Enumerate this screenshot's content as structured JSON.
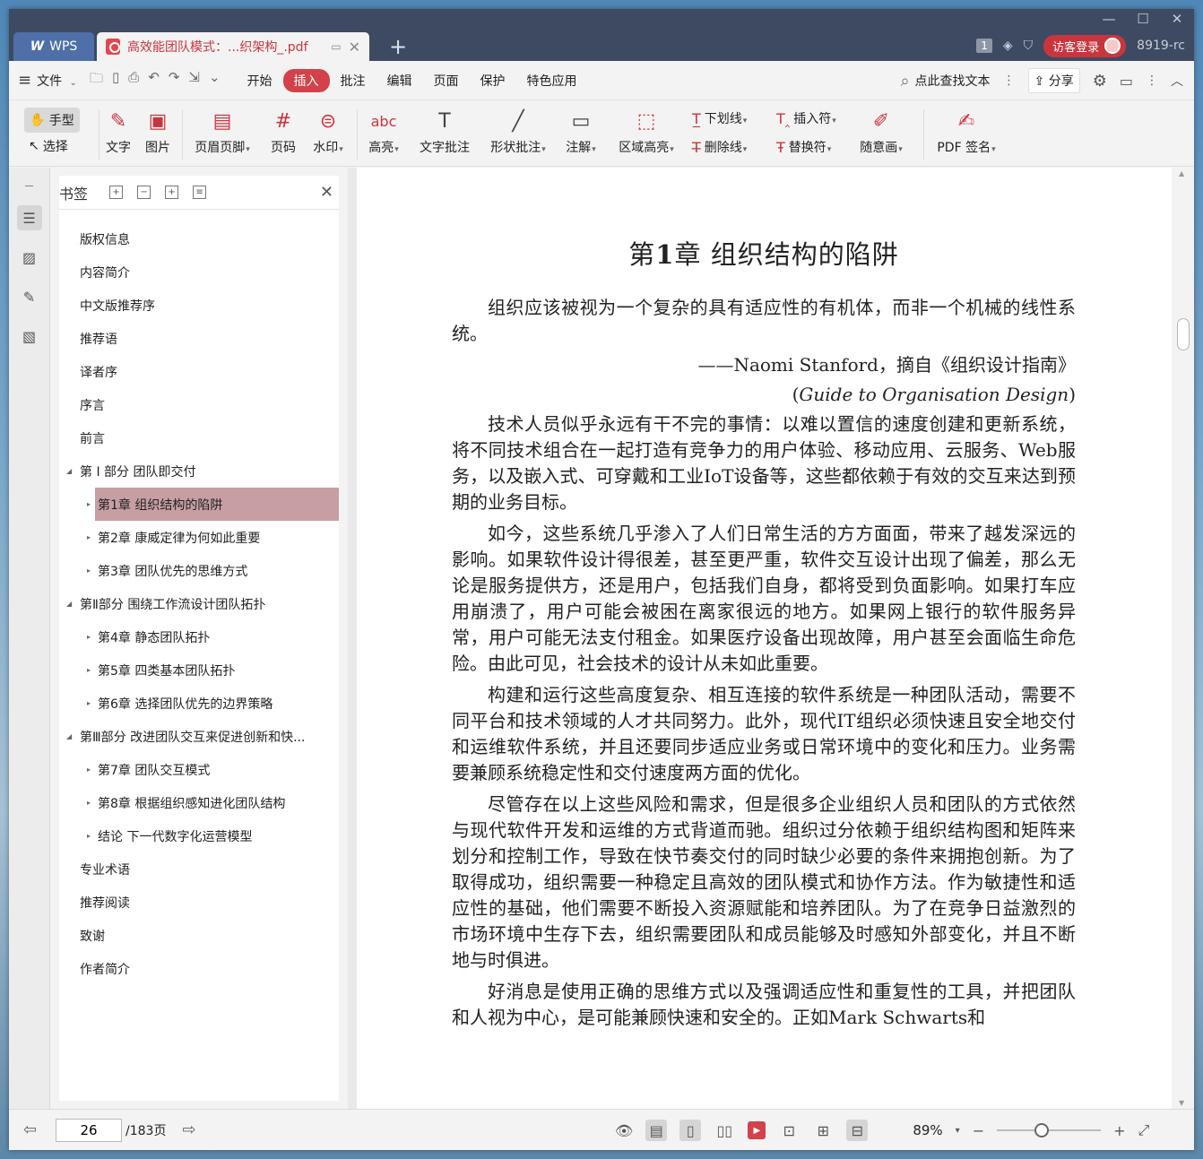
{
  "titlebar": {
    "wps_tab": "WPS",
    "doc_tab": "高效能团队模式：...织架构_.pdf",
    "badge": "1",
    "login": "访客登录",
    "version": "8919-rc"
  },
  "menubar": {
    "file": "文件",
    "items": [
      "开始",
      "插入",
      "批注",
      "编辑",
      "页面",
      "保护",
      "特色应用"
    ],
    "active": "插入",
    "search": "点此查找文本",
    "share": "分享"
  },
  "ribbon": {
    "hand": "手型",
    "select": "选择",
    "text": "文字",
    "image": "图片",
    "header_footer": "页眉页脚",
    "page_num": "页码",
    "watermark": "水印",
    "highlight": "高亮",
    "text_comment": "文字批注",
    "shape_comment": "形状批注",
    "note": "注解",
    "area_highlight": "区域高亮",
    "underline": "下划线",
    "strikethrough": "删除线",
    "insert_mark": "插入符",
    "replace_mark": "替换符",
    "freehand": "随意画",
    "pdf_sign": "PDF 签名"
  },
  "bookmarks": {
    "title": "书签",
    "items": [
      {
        "label": "版权信息",
        "level": 0,
        "arrow": ""
      },
      {
        "label": "内容简介",
        "level": 0,
        "arrow": ""
      },
      {
        "label": "中文版推荐序",
        "level": 0,
        "arrow": ""
      },
      {
        "label": "推荐语",
        "level": 0,
        "arrow": ""
      },
      {
        "label": "译者序",
        "level": 0,
        "arrow": ""
      },
      {
        "label": "序言",
        "level": 0,
        "arrow": ""
      },
      {
        "label": "前言",
        "level": 0,
        "arrow": ""
      },
      {
        "label": "第 I 部分 团队即交付",
        "level": 0,
        "arrow": "down"
      },
      {
        "label": "第1章 组织结构的陷阱",
        "level": 1,
        "arrow": "right",
        "selected": true
      },
      {
        "label": "第2章 康威定律为何如此重要",
        "level": 1,
        "arrow": "right"
      },
      {
        "label": "第3章 团队优先的思维方式",
        "level": 1,
        "arrow": "right"
      },
      {
        "label": "第Ⅱ部分 围绕工作流设计团队拓扑",
        "level": 0,
        "arrow": "down"
      },
      {
        "label": "第4章 静态团队拓扑",
        "level": 1,
        "arrow": "right"
      },
      {
        "label": "第5章 四类基本团队拓扑",
        "level": 1,
        "arrow": "right"
      },
      {
        "label": "第6章 选择团队优先的边界策略",
        "level": 1,
        "arrow": "right"
      },
      {
        "label": "第Ⅲ部分 改进团队交互来促进创新和快...",
        "level": 0,
        "arrow": "down"
      },
      {
        "label": "第7章 团队交互模式",
        "level": 1,
        "arrow": "right"
      },
      {
        "label": "第8章 根据组织感知进化团队结构",
        "level": 1,
        "arrow": "right"
      },
      {
        "label": "结论 下一代数字化运营模型",
        "level": 1,
        "arrow": "right"
      },
      {
        "label": "专业术语",
        "level": 0,
        "arrow": ""
      },
      {
        "label": "推荐阅读",
        "level": 0,
        "arrow": ""
      },
      {
        "label": "致谢",
        "level": 0,
        "arrow": ""
      },
      {
        "label": "作者简介",
        "level": 0,
        "arrow": ""
      }
    ]
  },
  "document": {
    "chapter_prefix": "第",
    "chapter_num": "1",
    "chapter_rest": "章 组织结构的陷阱",
    "epigraph": "组织应该被视为一个复杂的具有适应性的有机体，而非一个机械的线性系统。",
    "quote_source": "——Naomi Stanford，摘自《组织设计指南》",
    "quote_source_en_open": "(",
    "quote_source_en": "Guide to Organisation Design",
    "quote_source_en_close": ")",
    "paragraphs": [
      "技术人员似乎永远有干不完的事情：以难以置信的速度创建和更新系统，将不同技术组合在一起打造有竞争力的用户体验、移动应用、云服务、Web服务，以及嵌入式、可穿戴和工业IoT设备等，这些都依赖于有效的交互来达到预期的业务目标。",
      "如今，这些系统几乎渗入了人们日常生活的方方面面，带来了越发深远的影响。如果软件设计得很差，甚至更严重，软件交互设计出现了偏差，那么无论是服务提供方，还是用户，包括我们自身，都将受到负面影响。如果打车应用崩溃了，用户可能会被困在离家很远的地方。如果网上银行的软件服务异常，用户可能无法支付租金。如果医疗设备出现故障，用户甚至会面临生命危险。由此可见，社会技术的设计从未如此重要。",
      "构建和运行这些高度复杂、相互连接的软件系统是一种团队活动，需要不同平台和技术领域的人才共同努力。此外，现代IT组织必须快速且安全地交付和运维软件系统，并且还要同步适应业务或日常环境中的变化和压力。业务需要兼顾系统稳定性和交付速度两方面的优化。",
      "尽管存在以上这些风险和需求，但是很多企业组织人员和团队的方式依然与现代软件开发和运维的方式背道而驰。组织过分依赖于组织结构图和矩阵来划分和控制工作，导致在快节奏交付的同时缺少必要的条件来拥抱创新。为了取得成功，组织需要一种稳定且高效的团队模式和协作方法。作为敏捷性和适应性的基础，他们需要不断投入资源赋能和培养团队。为了在竞争日益激烈的市场环境中生存下去，组织需要团队和成员能够及时感知外部变化，并且不断地与时俱进。",
      "好消息是使用正确的思维方式以及强调适应性和重复性的工具，并把团队和人视为中心，是可能兼顾快速和安全的。正如Mark Schwarts和"
    ]
  },
  "statusbar": {
    "page": "26",
    "total": "/183页",
    "zoom": "89%"
  }
}
